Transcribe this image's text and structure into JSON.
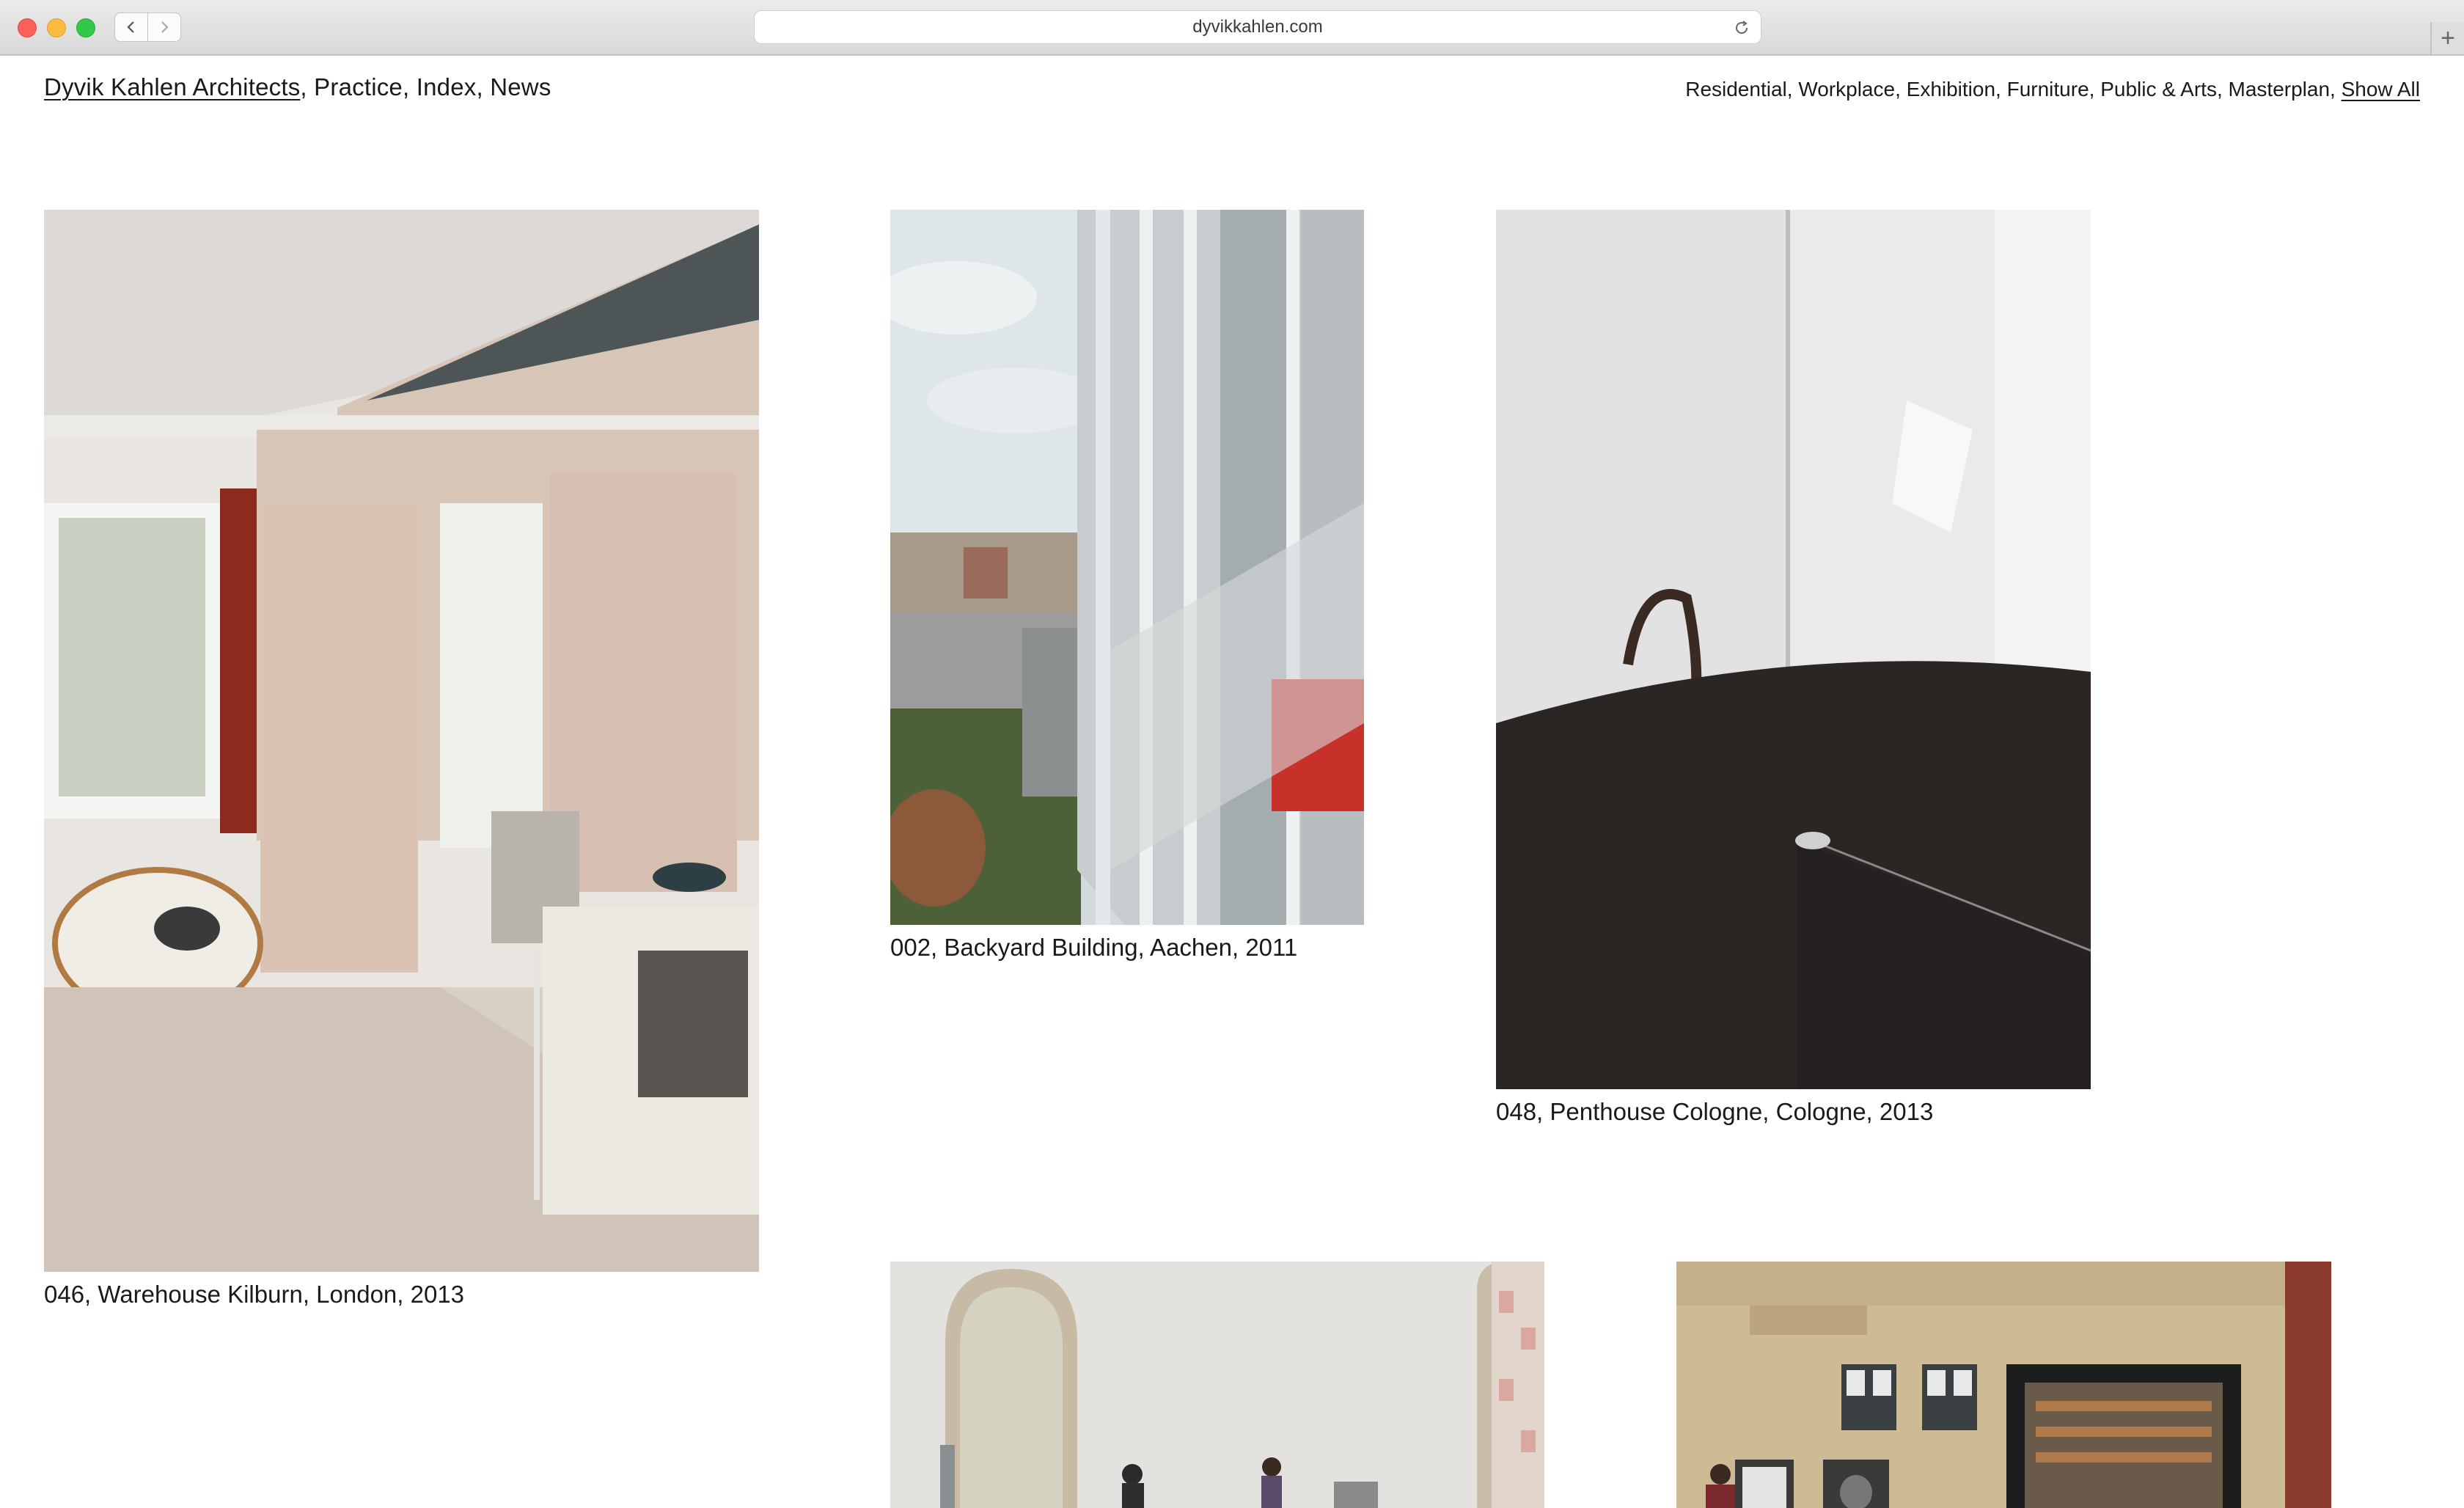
{
  "browser": {
    "url": "dyvikkahlen.com",
    "back_icon": "chevron-left-icon",
    "forward_icon": "chevron-right-icon",
    "reload_icon": "reload-icon",
    "new_tab_label": "+"
  },
  "site_nav": {
    "brand": "Dyvik Kahlen Architects",
    "links": [
      "Practice",
      "Index",
      "News"
    ]
  },
  "category_nav": {
    "items": [
      "Residential",
      "Workplace",
      "Exhibition",
      "Furniture",
      "Public & Arts",
      "Masterplan"
    ],
    "show_all": "Show All"
  },
  "projects": [
    {
      "caption": "046, Warehouse Kilburn, London, 2013"
    },
    {
      "caption": "002, Backyard Building, Aachen, 2011"
    },
    {
      "caption": "048, Penthouse Cologne, Cologne, 2013"
    },
    {
      "caption": ""
    },
    {
      "caption": ""
    }
  ],
  "colors": {
    "text": "#1a1a1a",
    "traffic_red": "#fc605b",
    "traffic_yellow": "#fdbc40",
    "traffic_green": "#34c84a"
  }
}
